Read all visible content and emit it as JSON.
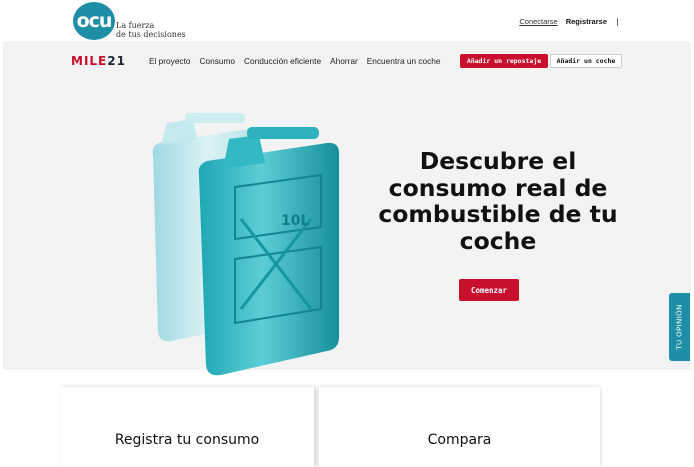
{
  "header": {
    "logo_text": "ocu",
    "tagline_line1": "La fuerza",
    "tagline_line2": "de tus decisiones",
    "login_label": "Conectarse",
    "register_label": "Registrarse"
  },
  "hero": {
    "brand": {
      "prefix": "MILE",
      "suffix": "21"
    },
    "nav": [
      "El proyecto",
      "Consumo",
      "Conducción eficiente",
      "Ahorrar",
      "Encuentra un coche"
    ],
    "add_refuel_label": "Añadir un repostaje",
    "add_car_label": "Añadir un coche",
    "jerrycan_label": "10L",
    "title": "Descubre el consumo real de combustible de tu coche",
    "start_label": "Comenzar"
  },
  "feedback_tab_label": "TU OPINIÓN",
  "cards": [
    {
      "title": "Registra tu consumo"
    },
    {
      "title": "Compara"
    }
  ],
  "colors": {
    "accent": "#c8102e",
    "brand_teal": "#1e8ea6",
    "hero_background": "#f3f3f3"
  }
}
